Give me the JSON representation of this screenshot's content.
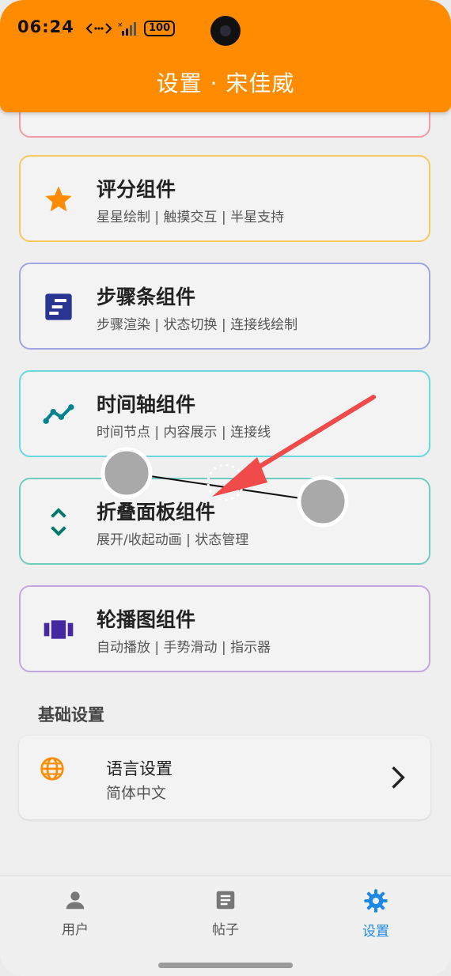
{
  "status": {
    "time": "06:24",
    "battery": "100"
  },
  "header": {
    "title": "设置 · 宋佳威"
  },
  "cards": [
    {
      "title": "评分组件",
      "subtitle": "星星绘制 | 触摸交互 | 半星支持",
      "icon": "star-icon",
      "color": "#f7c95e",
      "icon_color": "#ff8c00"
    },
    {
      "title": "步骤条组件",
      "subtitle": "步骤渲染 | 状态切换 | 连接线绘制",
      "icon": "steps-icon",
      "color": "#9fa6e0",
      "icon_color": "#283593"
    },
    {
      "title": "时间轴组件",
      "subtitle": "时间节点 | 内容展示 | 连接线",
      "icon": "timeline-icon",
      "color": "#6ad8df",
      "icon_color": "#00838f"
    },
    {
      "title": "折叠面板组件",
      "subtitle": "展开/收起动画 | 状态管理",
      "icon": "expand-collapse-icon",
      "color": "#6fcdbd",
      "icon_color": "#00796b"
    },
    {
      "title": "轮播图组件",
      "subtitle": "自动播放 | 手势滑动 | 指示器",
      "icon": "carousel-icon",
      "color": "#c2a6e0",
      "icon_color": "#4527a0"
    }
  ],
  "section": {
    "title": "基础设置"
  },
  "language": {
    "title": "语言设置",
    "value": "简体中文",
    "icon": "globe-icon"
  },
  "tabs": [
    {
      "label": "用户",
      "icon": "person-icon"
    },
    {
      "label": "帖子",
      "icon": "article-icon"
    },
    {
      "label": "设置",
      "icon": "gear-icon",
      "active": true
    }
  ],
  "colors": {
    "accent": "#ff8c00",
    "active_tab": "#1e88e5"
  }
}
